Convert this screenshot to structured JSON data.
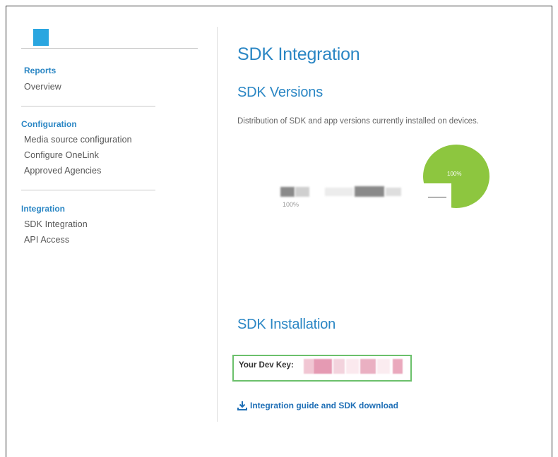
{
  "sidebar": {
    "sections": [
      {
        "heading": "Reports",
        "items": [
          "Overview"
        ]
      },
      {
        "heading": "Configuration",
        "items": [
          "Media source configuration",
          "Configure OneLink",
          "Approved Agencies"
        ]
      },
      {
        "heading": "Integration",
        "items": [
          "SDK Integration",
          "API Access"
        ]
      }
    ]
  },
  "main": {
    "title": "SDK Integration",
    "versions": {
      "heading": "SDK Versions",
      "description": "Distribution of SDK and app versions currently installed on devices.",
      "bar_percent_label": "100%",
      "pie_percent_label": "100%",
      "pie_color": "#8dc63f"
    },
    "installation": {
      "heading": "SDK Installation",
      "dev_key_label": "Your Dev Key:",
      "guide_link": "Integration guide and SDK download"
    }
  },
  "colors": {
    "accent": "#2a86c4",
    "highlight_box": "#6bc06b"
  }
}
